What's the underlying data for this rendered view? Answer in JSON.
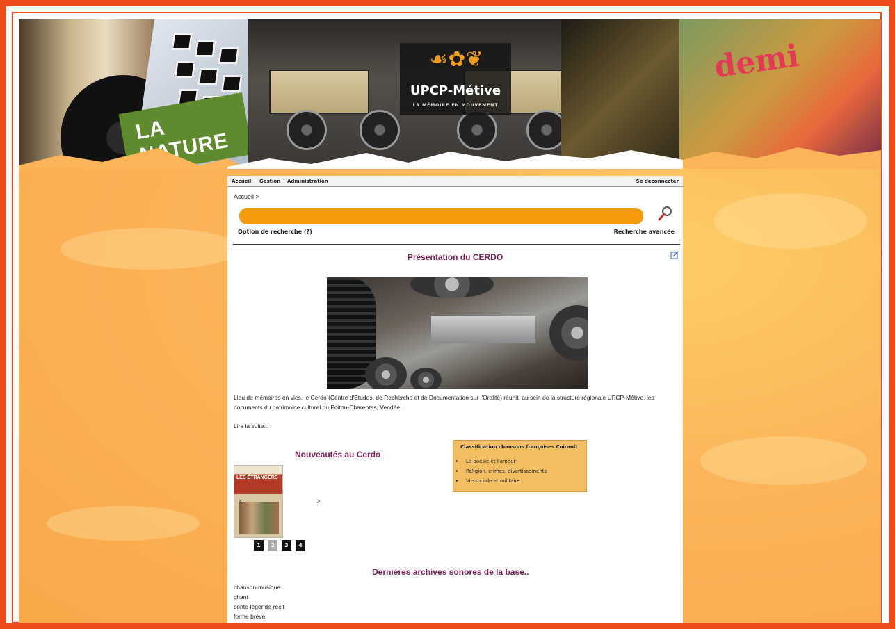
{
  "banner": {
    "logo_title": "UPCP-Métive",
    "logo_tagline": "LA MÉMOIRE EN MOUVEMENT",
    "poster_text": "LA NATURE",
    "art_text": "demi"
  },
  "menu": {
    "items": [
      "Accueil",
      "Gestion",
      "Administration"
    ],
    "logout": "Se déconnecter"
  },
  "breadcrumb": "Accueil >",
  "search": {
    "placeholder": "",
    "options_label": "Option de recherche (?)",
    "advanced_label": "Recherche avancée"
  },
  "presentation": {
    "title": "Présentation du CERDO",
    "text": "Lieu de mémoires en vies, le Cerdo (Centre d'Etudes, de Recherche et de Documentation sur l'Oralité) réunit, au sein de la structure régionale UPCP-Métive, les documents du patrimoine culturel du Poitou-Charentes, Vendée.",
    "read_more": "Lire la suite..."
  },
  "news": {
    "title": "Nouveautés au Cerdo",
    "book_title": "LES ÉTRANGERS",
    "prev": "<",
    "next": ">",
    "pages": [
      "1",
      "2",
      "3",
      "4"
    ],
    "active_page": 2
  },
  "classification": {
    "title": "Classification chansons françaises Coirault",
    "items": [
      "La poésie et l'amour",
      "Religion, crimes, divertissements",
      "Vie sociale et militaire"
    ]
  },
  "archives": {
    "title": "Dernières archives sonores de la base..",
    "items": [
      "chanson-musique",
      "chant",
      "conte-légende-récit",
      "forme brève"
    ]
  },
  "colors": {
    "frame": "#ef4a1c",
    "background": "#fbb458",
    "search_bar": "#f59b0b",
    "heading": "#7a1d56",
    "classification_box": "#f3be62"
  }
}
